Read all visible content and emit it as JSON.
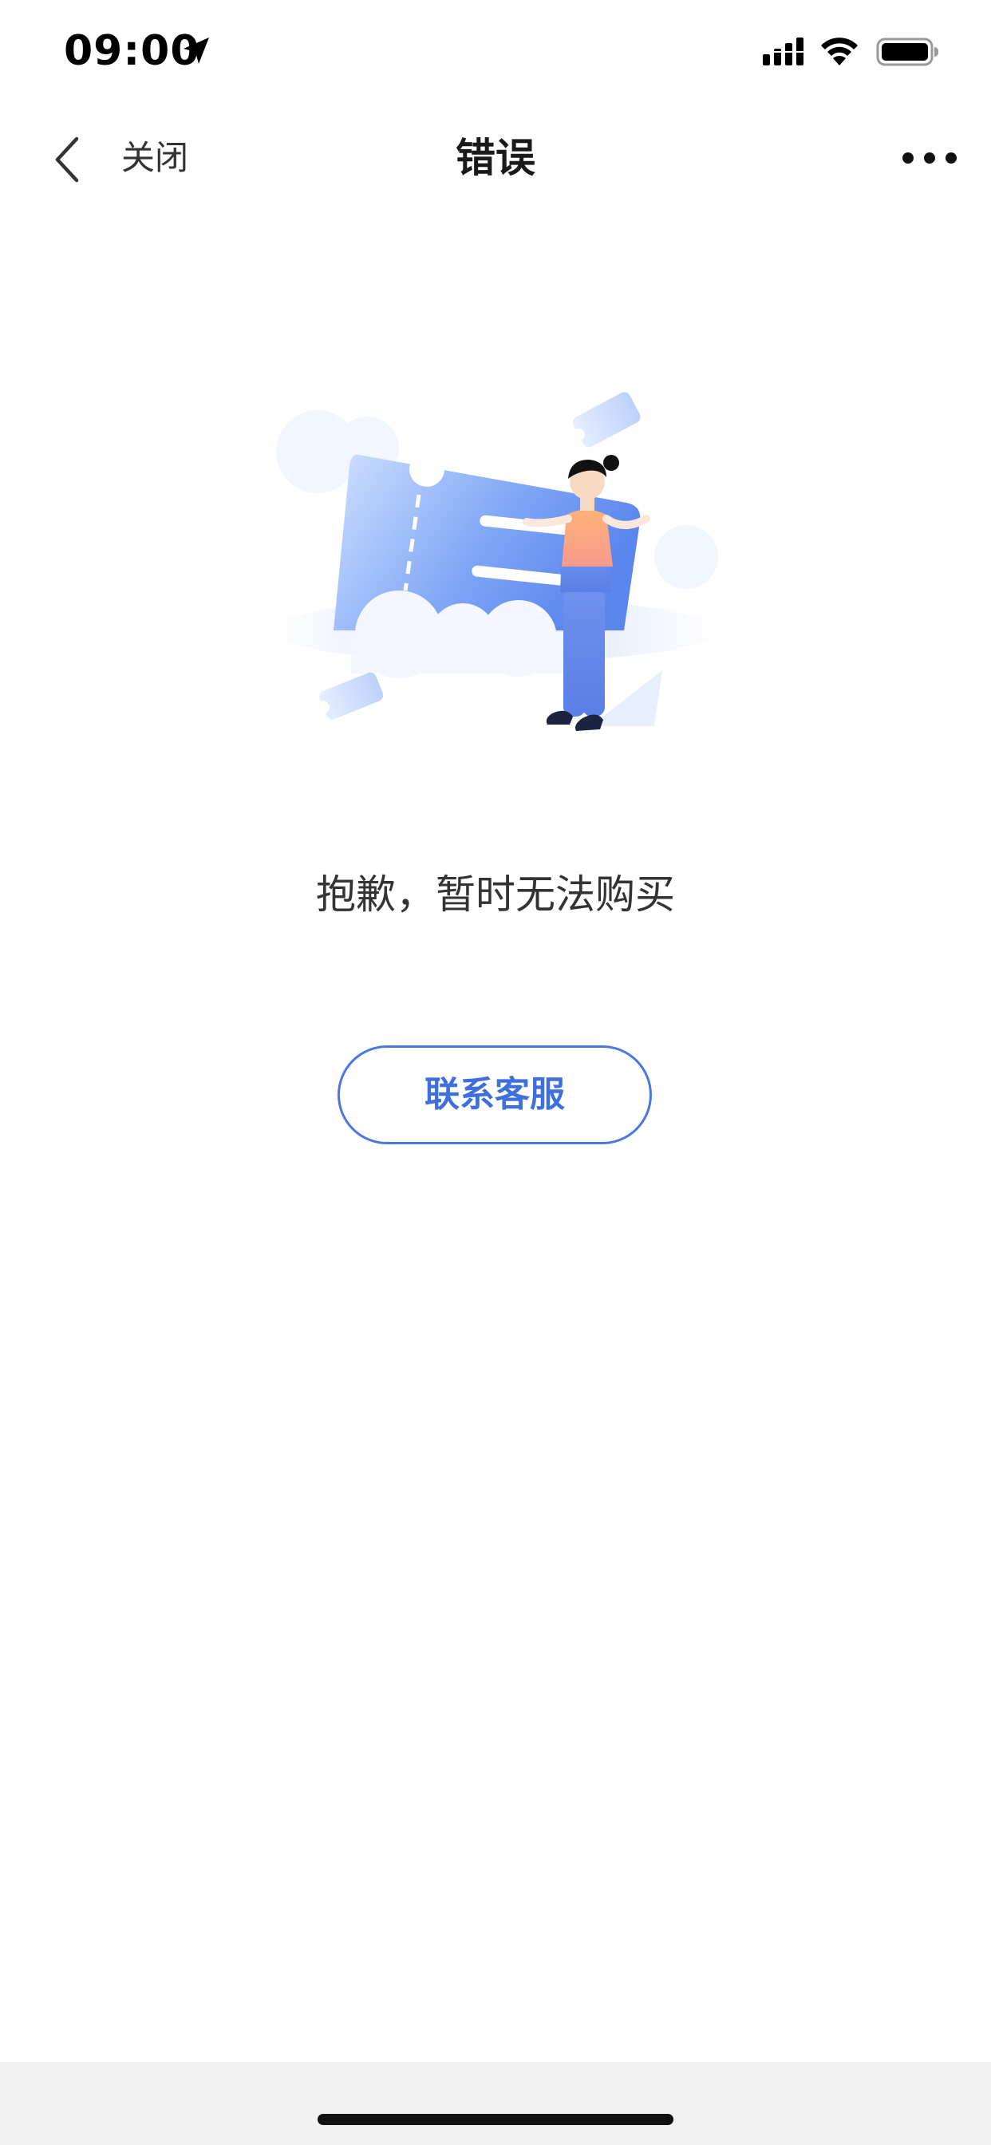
{
  "status_bar": {
    "time": "09:00",
    "icons": [
      "location-arrow-icon",
      "signal-icon",
      "wifi-icon",
      "battery-icon"
    ]
  },
  "nav": {
    "back_icon": "chevron-left-icon",
    "close_label": "关闭",
    "title": "错误",
    "more_icon": "more-dots-icon"
  },
  "illustration": {
    "subject": "person-with-ticket-illustration"
  },
  "message": "抱歉，暂时无法购买",
  "contact_button": {
    "label": "联系客服"
  },
  "colors": {
    "accent": "#4a78e0",
    "text_primary": "#1a1a1a",
    "text_secondary": "#333333",
    "background": "#ffffff",
    "home_bar_bg": "#f2f2f2"
  }
}
